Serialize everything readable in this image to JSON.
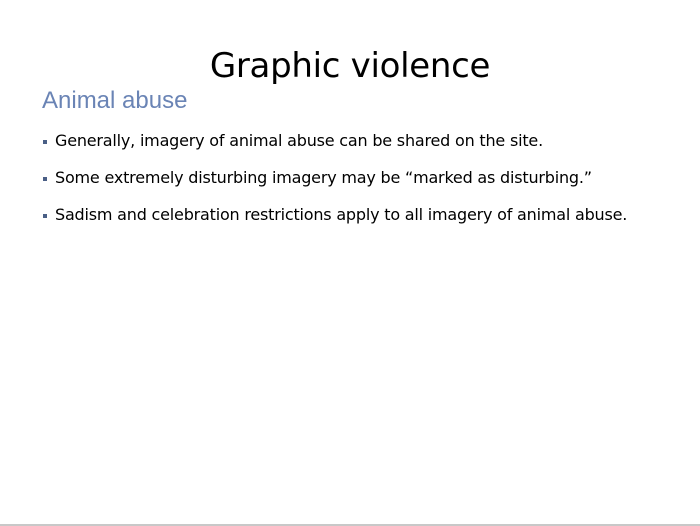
{
  "slide": {
    "title": "Graphic violence",
    "subtitle": "Animal abuse",
    "bullets": [
      "Generally, imagery of animal abuse can be shared on the site.",
      "Some extremely disturbing imagery may be “marked as disturbing.”",
      "Sadism and celebration restrictions apply to all imagery of animal abuse."
    ]
  },
  "colors": {
    "subtitle": "#6a84b5",
    "bullet_marker": "#4a5f86",
    "text": "#000000",
    "background": "#ffffff"
  }
}
